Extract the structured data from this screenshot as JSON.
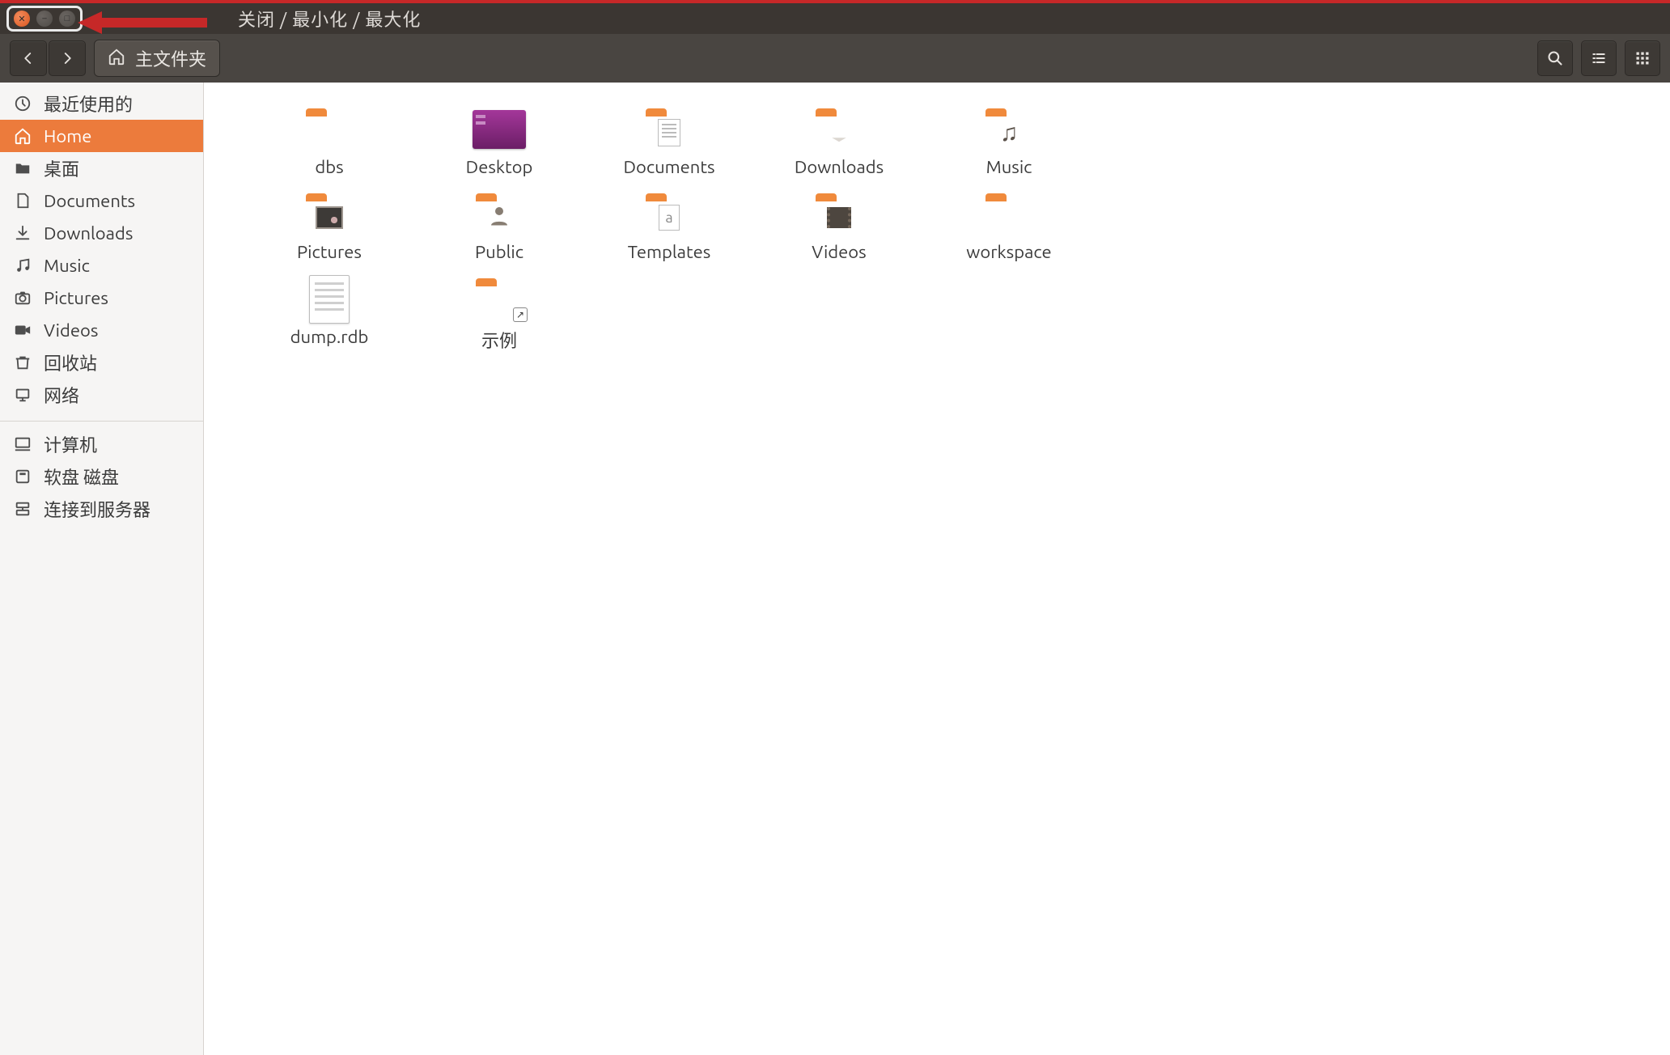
{
  "titlebar": {
    "annotation": "关闭 / 最小化 / 最大化"
  },
  "toolbar": {
    "path_label": "主文件夹"
  },
  "sidebar": {
    "top": [
      {
        "icon": "clock",
        "label": "最近使用的"
      },
      {
        "icon": "home",
        "label": "Home",
        "active": true
      },
      {
        "icon": "folder",
        "label": "桌面"
      },
      {
        "icon": "file",
        "label": "Documents"
      },
      {
        "icon": "download",
        "label": "Downloads"
      },
      {
        "icon": "music",
        "label": "Music"
      },
      {
        "icon": "camera",
        "label": "Pictures"
      },
      {
        "icon": "video",
        "label": "Videos"
      },
      {
        "icon": "trash",
        "label": "回收站"
      },
      {
        "icon": "network",
        "label": "网络"
      }
    ],
    "bottom": [
      {
        "icon": "computer",
        "label": "计算机"
      },
      {
        "icon": "disk",
        "label": "软盘 磁盘"
      },
      {
        "icon": "server",
        "label": "连接到服务器"
      }
    ]
  },
  "files": [
    {
      "name": "dbs",
      "type": "folder"
    },
    {
      "name": "Desktop",
      "type": "desktop"
    },
    {
      "name": "Documents",
      "type": "folder",
      "overlay": "doc"
    },
    {
      "name": "Downloads",
      "type": "folder",
      "overlay": "dl"
    },
    {
      "name": "Music",
      "type": "folder",
      "overlay": "note"
    },
    {
      "name": "Pictures",
      "type": "folder",
      "overlay": "pic"
    },
    {
      "name": "Public",
      "type": "folder",
      "overlay": "user"
    },
    {
      "name": "Templates",
      "type": "folder",
      "overlay": "tpl"
    },
    {
      "name": "Videos",
      "type": "folder",
      "overlay": "vid"
    },
    {
      "name": "workspace",
      "type": "folder"
    },
    {
      "name": "dump.rdb",
      "type": "file"
    },
    {
      "name": "示例",
      "type": "folder",
      "link": true
    }
  ]
}
